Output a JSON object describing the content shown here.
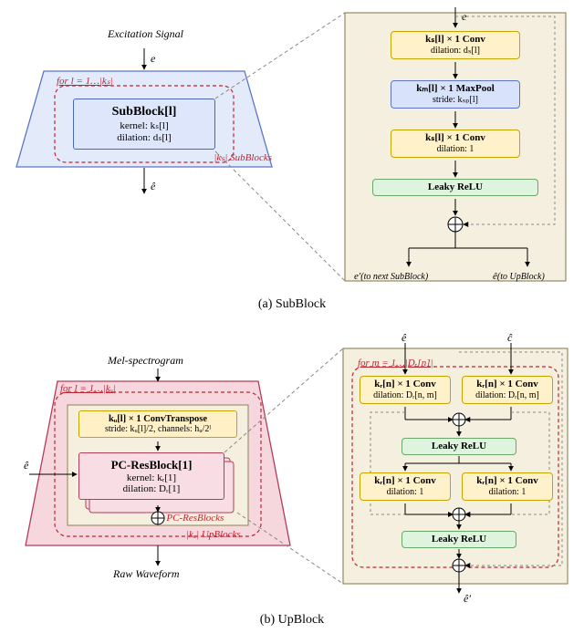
{
  "panel_a": {
    "label": "(a) SubBlock",
    "left": {
      "input_label": "Excitation Signal",
      "e_symbol": "e",
      "loop_text": "for l = 1…|kₛ|",
      "subblock_title": "SubBlock[l]",
      "subblock_kernel": "kernel: kₛ[l]",
      "subblock_dilation": "dilation: dₛ[l]",
      "caption_count": "|kₛ| SubBlocks",
      "out_symbol": "ê"
    },
    "right": {
      "in_symbol": "e",
      "conv1_title": "kₛ[l] × 1 Conv",
      "conv1_sub": "dilation: dₛ[l]",
      "pool_title": "kₘ[l] × 1 MaxPool",
      "pool_sub": "stride: kₛₚ[l]",
      "conv2_title": "kₛ[l] × 1 Conv",
      "conv2_sub": "dilation: 1",
      "lrelu": "Leaky ReLU",
      "out_left": "e′ (to next SubBlock)",
      "out_right": "ê (to UpBlock)"
    }
  },
  "panel_b": {
    "label": "(b) UpBlock",
    "left": {
      "input_label": "Mel-spectrogram",
      "ehat_in": "ê",
      "loop_text": "for l = 1…|kᵤ|",
      "convtr_title": "kᵤ[l] × 1 ConvTranspose",
      "convtr_sub": "stride: kᵤ[l]/2, channels: hᵤ/2ˡ",
      "pcres_title": "PC-ResBlock[1]",
      "pcres_kernel": "kernel: kᵣ[1]",
      "pcres_dilation": "dilation: Dᵣ[1]",
      "pcres_count": "|kᵣ| PC-ResBlocks",
      "upblock_count": "|kᵤ| UpBlocks",
      "out_label": "Raw Waveform"
    },
    "right": {
      "ehat": "ê",
      "chat": "ĉ",
      "loop_text": "for m = 1…|Dᵣ[n]|",
      "conv_top_title": "kᵣ[n] × 1 Conv",
      "conv_top_sub": "dilation: Dᵣ[n, m]",
      "lrelu": "Leaky ReLU",
      "conv_bot_title": "kᵣ[n] × 1 Conv",
      "conv_bot_sub": "dilation: 1",
      "out": "ê′"
    }
  }
}
